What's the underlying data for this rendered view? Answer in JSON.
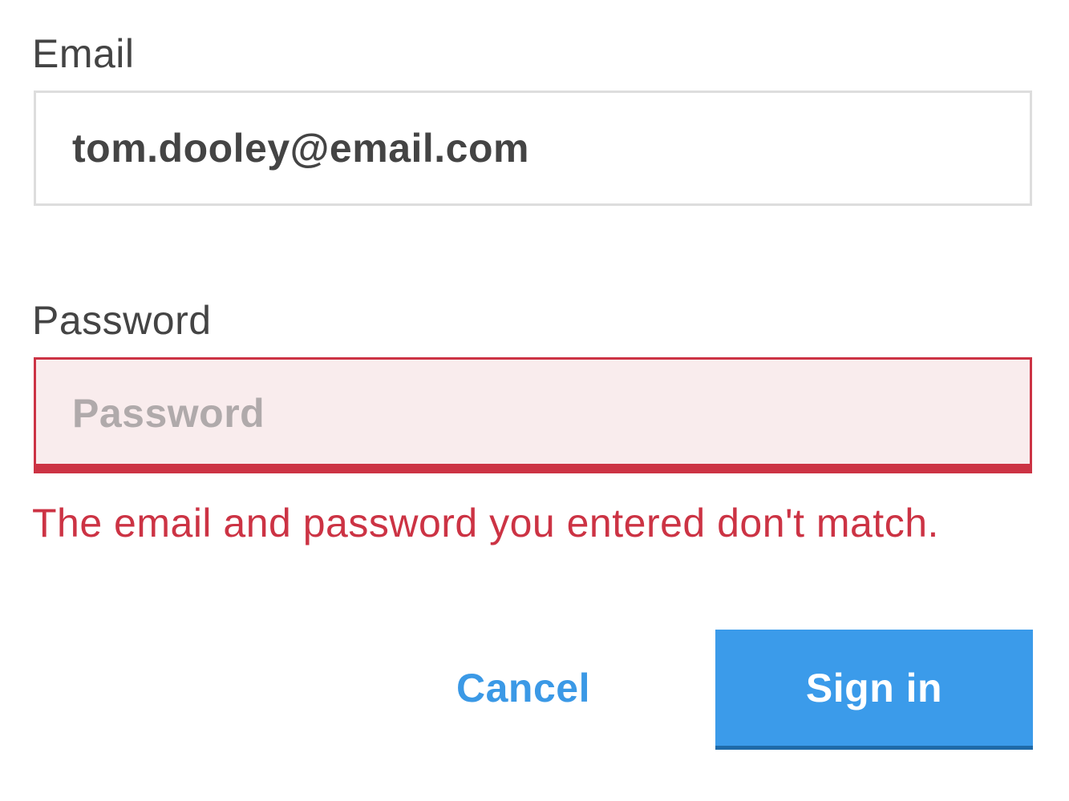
{
  "form": {
    "email": {
      "label": "Email",
      "value": "tom.dooley@email.com"
    },
    "password": {
      "label": "Password",
      "placeholder": "Password",
      "value": ""
    },
    "error_message": "The email and password you entered don't match.",
    "cancel_label": "Cancel",
    "signin_label": "Sign in"
  },
  "colors": {
    "label_text": "#444444",
    "input_border": "#dddddd",
    "error_red": "#cc3344",
    "error_bg": "#f9eced",
    "placeholder_gray": "#b0aaab",
    "accent_blue": "#3b9bea",
    "button_shadow": "#1f6aa8"
  }
}
